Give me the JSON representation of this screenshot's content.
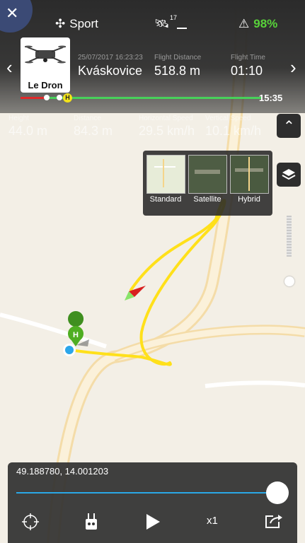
{
  "status_bar": {
    "mode": "Sport",
    "satellites": "17",
    "battery": "98%",
    "battery_color": "#58d23a"
  },
  "flight": {
    "drone_name": "Le Dron",
    "datetime": "25/07/2017 16:23:23",
    "location": "Kváskovice",
    "distance_label": "Flight Distance",
    "distance": "518.8 m",
    "time_label": "Flight Time",
    "time": "01:10",
    "timeline_end": "15:35",
    "home_marker": "H"
  },
  "telemetry": {
    "height_label": "Height",
    "height": "44.0 m",
    "distance_label": "Distance",
    "distance": "84.3 m",
    "hspeed_label": "Horizontal Speed",
    "hspeed": "29.5 km/h",
    "vspeed_label": "Vertical Speed",
    "vspeed": "10.1 km/h"
  },
  "map_layers": {
    "options": [
      "Standard",
      "Satellite",
      "Hybrid"
    ],
    "selected": "Satellite"
  },
  "map": {
    "home_label": "H"
  },
  "playback": {
    "coordinates": "49.188780, 14.001203",
    "progress": 1.0,
    "speed": "x1"
  },
  "icons": {
    "close": "close-icon",
    "mode": "drone-mode-icon",
    "gps": "satellite-icon",
    "battery": "battery-icon",
    "prev": "chevron-left-icon",
    "next": "chevron-right-icon",
    "collapse": "chevron-up-icon",
    "layers": "layers-icon",
    "locate": "crosshair-icon",
    "remote": "remote-controller-icon",
    "play": "play-icon",
    "share": "share-icon"
  }
}
